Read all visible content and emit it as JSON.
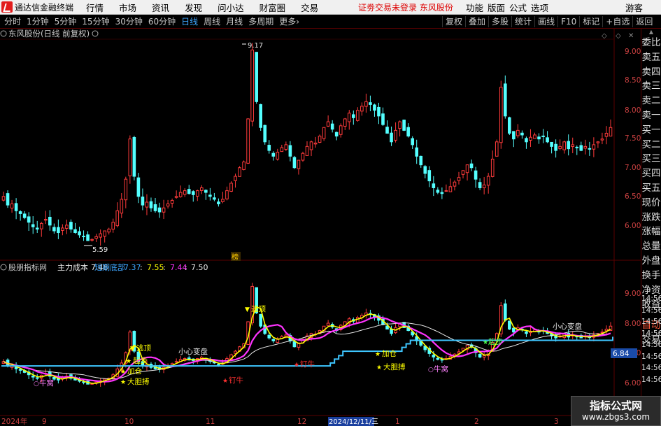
{
  "app": {
    "title": "通达信金融终端",
    "menu": [
      "行情",
      "市场",
      "资讯",
      "发现",
      "问小达",
      "财富圈",
      "交易"
    ],
    "notice": "证劵交易未登录  东风股份",
    "right_menu": [
      "功能",
      "版面",
      "公式",
      "选项"
    ],
    "guest": "游客"
  },
  "toolbar": {
    "periods": [
      "分时",
      "1分钟",
      "5分钟",
      "15分钟",
      "30分钟",
      "60分钟",
      "日线",
      "周线",
      "月线",
      "多周期"
    ],
    "active_period": "日线",
    "more": "更多",
    "more_arrow": "›",
    "right_buttons": [
      "复权",
      "叠加",
      "多股",
      "统计",
      "画线",
      "F10",
      "标记",
      "+自选",
      "返回"
    ]
  },
  "sidebar": {
    "top": [
      "委比",
      "卖五",
      "卖四",
      "卖三",
      "卖二",
      "卖一",
      "买一",
      "买二",
      "买三",
      "买四",
      "买五",
      "现价",
      "涨跌",
      "涨幅",
      "总量",
      "外盘",
      "换手",
      "净资",
      "收益"
    ],
    "bottom": [
      "自动",
      "交易"
    ]
  },
  "main_panel": {
    "title": "东风股份(日线 前复权)",
    "high_label": "9.17",
    "low_label": "5.59",
    "badge": "榜",
    "axis_ticks": [
      "9.00",
      "8.50",
      "8.00",
      "7.50",
      "7.00",
      "6.50",
      "6.00"
    ]
  },
  "indicator_panel": {
    "name": "股朋指标网",
    "cost_label": "主力成本",
    "cost_value": "7.48",
    "bottom_label": "短期底部",
    "v1": "7.37",
    "v2": "7.55",
    "v3": "7.44",
    "v4": "7.50",
    "axis_ticks": [
      "9.00",
      "8.00",
      "7.00",
      "6.00"
    ],
    "axis_side": [
      "14:56",
      "14:56",
      "14:56",
      "14:56",
      "14:56",
      "14:56",
      "14:56",
      "14:56"
    ],
    "price_tag": "6.84",
    "annotations": [
      "逃顶",
      "逃顶",
      "小心变盘",
      "小心变盘",
      "起步",
      "起步",
      "大胆搏",
      "大胆搏",
      "加仓",
      "加仓",
      "钉牛",
      "钉牛",
      "牛窝",
      "牛窝"
    ]
  },
  "date_axis": {
    "labels": [
      "2024年",
      "9",
      "10",
      "11",
      "12",
      "2024/12/11/三",
      "1",
      "2",
      "3"
    ]
  },
  "watermark": {
    "line1": "指标公式网",
    "line2": "www.zbgs3.com"
  },
  "colors": {
    "up": "#ff3b3b",
    "down": "#54ffff",
    "grid": "#5a0000",
    "accent": "#3ea6ff",
    "yellow": "#ffff00",
    "magenta": "#ff33ff"
  },
  "chart_data": {
    "type": "candlestick",
    "price_range": [
      5.5,
      9.3
    ],
    "closes": [
      6.55,
      6.4,
      6.42,
      6.3,
      6.25,
      6.18,
      6.1,
      6.02,
      5.98,
      6.08,
      6.15,
      6.05,
      5.95,
      5.92,
      6.0,
      6.05,
      5.98,
      5.92,
      5.88,
      5.85,
      5.78,
      5.8,
      5.85,
      5.9,
      5.95,
      5.98,
      6.1,
      6.3,
      6.5,
      6.85,
      7.55,
      6.9,
      6.55,
      6.4,
      6.45,
      6.35,
      6.3,
      6.28,
      6.35,
      6.42,
      6.48,
      6.55,
      6.62,
      6.65,
      6.6,
      6.58,
      6.65,
      6.7,
      6.62,
      6.55,
      6.5,
      6.42,
      6.5,
      6.65,
      6.78,
      6.9,
      7.05,
      7.15,
      7.9,
      9.1,
      8.2,
      7.75,
      7.5,
      7.35,
      7.25,
      7.32,
      7.4,
      7.45,
      7.25,
      7.05,
      7.18,
      7.3,
      7.42,
      7.5,
      7.48,
      7.6,
      7.75,
      7.85,
      7.72,
      7.6,
      7.78,
      7.9,
      8.0,
      7.92,
      8.05,
      8.12,
      8.2,
      8.15,
      8.05,
      7.95,
      7.8,
      7.65,
      7.5,
      7.7,
      7.85,
      7.7,
      7.6,
      7.45,
      7.25,
      7.1,
      6.95,
      6.82,
      6.7,
      6.62,
      6.6,
      6.65,
      6.72,
      6.8,
      6.88,
      7.0,
      7.1,
      7.05,
      6.85,
      6.7,
      6.75,
      6.9,
      7.2,
      7.5,
      8.45,
      7.95,
      7.65,
      7.55,
      7.7,
      7.62,
      7.5,
      7.58,
      7.62,
      7.55,
      7.6,
      7.5,
      7.42,
      7.35,
      7.42,
      7.5,
      7.38,
      7.45,
      7.4,
      7.35,
      7.42,
      7.38,
      7.45,
      7.5,
      7.55,
      7.65,
      7.75
    ],
    "high": 9.17,
    "low": 5.59,
    "indicator": {
      "main_cost": 7.48,
      "short_bottom": [
        7.37,
        7.55,
        7.44,
        7.5
      ],
      "last_tag": 6.84
    }
  }
}
